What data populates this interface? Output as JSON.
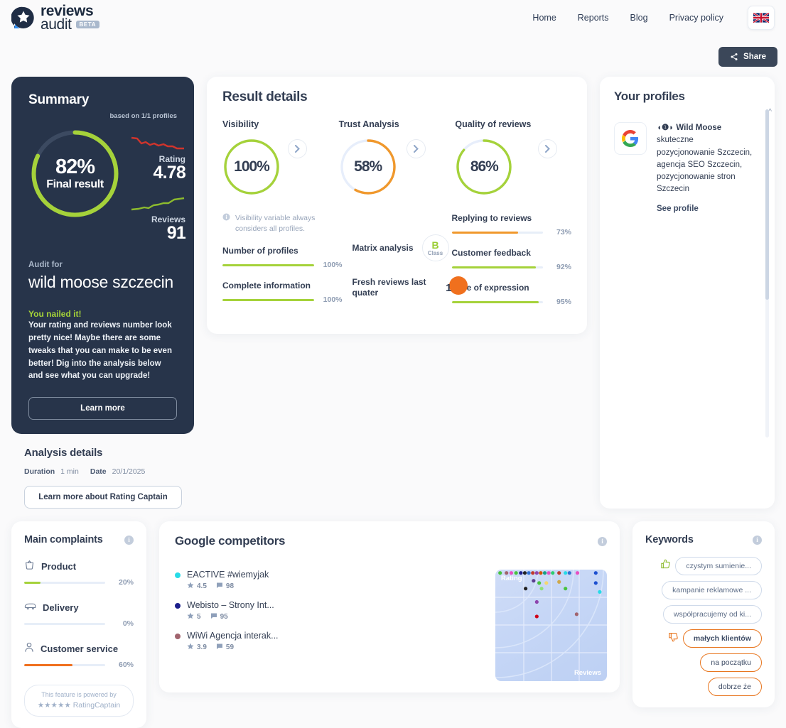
{
  "brand": {
    "line1": "reviews",
    "line2": "audit",
    "badge": "BETA"
  },
  "nav": {
    "items": [
      {
        "label": "Home"
      },
      {
        "label": "Reports"
      },
      {
        "label": "Blog"
      },
      {
        "label": "Privacy policy"
      }
    ],
    "language_flag": "uk-flag-icon"
  },
  "share": {
    "label": "Share",
    "icon": "share-icon"
  },
  "summary": {
    "title": "Summary",
    "based_on": "based on 1/1 profiles",
    "final_percent": "82%",
    "final_label": "Final result",
    "final_value": 82,
    "ring_color": "#a5d23a",
    "rating_label": "Rating",
    "rating_value": "4.78",
    "reviews_label": "Reviews",
    "reviews_value": "91",
    "audit_for_label": "Audit for",
    "audit_name": "wild moose szczecin",
    "callout_title": "You nailed it!",
    "callout_body": "Your rating and reviews number look pretty nice! Maybe there are some tweaks that you can make to be even better! Dig into the analysis below and see what you can upgrade!",
    "learn_more": "Learn more"
  },
  "analysis": {
    "title": "Analysis details",
    "duration_label": "Duration",
    "duration_value": "1 min",
    "date_label": "Date",
    "date_value": "20/1/2025",
    "button": "Learn more about Rating Captain"
  },
  "result_details": {
    "title": "Result details",
    "metrics": [
      {
        "title": "Visibility",
        "percent": "100%",
        "value": 100,
        "color": "#a5d23a"
      },
      {
        "title": "Trust Analysis",
        "percent": "58%",
        "value": 58,
        "color": "#f0982c"
      },
      {
        "title": "Quality of reviews",
        "percent": "86%",
        "value": 86,
        "color": "#a5d23a"
      }
    ],
    "note": "Visibility variable always considers all profiles.",
    "left_bars": [
      {
        "name": "Number of profiles",
        "percent": "100%",
        "value": 100,
        "color": "#a5d23a"
      },
      {
        "name": "Complete information",
        "percent": "100%",
        "value": 100,
        "color": "#a5d23a"
      }
    ],
    "middle": {
      "matrix_label": "Matrix analysis",
      "matrix_letter": "B",
      "matrix_class_word": "Class",
      "fresh_label": "Fresh reviews last quater",
      "fresh_value": "1",
      "fresh_color": "#f0701e"
    },
    "right_bars": [
      {
        "name": "Replying to reviews",
        "percent": "73%",
        "value": 73,
        "color": "#f0982c"
      },
      {
        "name": "Customer feedback",
        "percent": "92%",
        "value": 92,
        "color": "#a5d23a"
      },
      {
        "name": "Tone of expression",
        "percent": "95%",
        "value": 95,
        "color": "#a5d23a"
      }
    ]
  },
  "profiles": {
    "title": "Your profiles",
    "items": [
      {
        "source_icon": "google-icon",
        "prefix_glyphs": "◖❶◗",
        "name": "Wild Moose",
        "description": "skuteczne pozycjonowanie Szczecin, agencja SEO Szczecin, pozycjonowanie stron Szczecin",
        "link": "See profile"
      }
    ]
  },
  "complaints": {
    "title": "Main complaints",
    "items": [
      {
        "icon": "basket-icon",
        "name": "Product",
        "percent": "20%",
        "value": 20,
        "color": "#a5d23a"
      },
      {
        "icon": "truck-icon",
        "name": "Delivery",
        "percent": "0%",
        "value": 0,
        "color": "#a5d23a"
      },
      {
        "icon": "person-icon",
        "name": "Customer service",
        "percent": "60%",
        "value": 60,
        "color": "#f0701e"
      }
    ],
    "powered_line1": "This feature is powered by",
    "powered_stars": "★★★★★",
    "powered_brand": "RatingCaptain"
  },
  "competitors": {
    "title": "Google competitors",
    "items": [
      {
        "name": "EACTIVE #wiemyjak",
        "rating": "4.5",
        "reviews": "98",
        "color": "#27dbe7"
      },
      {
        "name": "Webisto – Strony Int...",
        "rating": "5",
        "reviews": "95",
        "color": "#1c1f8c"
      },
      {
        "name": "WiWi Agencja interak...",
        "rating": "3.9",
        "reviews": "59",
        "color": "#a1646e"
      }
    ],
    "chart_data": {
      "type": "scatter",
      "title": "",
      "xlabel": "Reviews",
      "ylabel": "Rating",
      "xlim": [
        0,
        100
      ],
      "ylim": [
        0,
        100
      ],
      "grid": true,
      "points": [
        {
          "x": 6,
          "y": 97,
          "color": "#47c33f"
        },
        {
          "x": 14,
          "y": 97,
          "color": "#a1646e"
        },
        {
          "x": 20,
          "y": 97,
          "color": "#e84fc2"
        },
        {
          "x": 26,
          "y": 97,
          "color": "#47c33f"
        },
        {
          "x": 32,
          "y": 97,
          "color": "#1c1f8c"
        },
        {
          "x": 37,
          "y": 97,
          "color": "#222222"
        },
        {
          "x": 42,
          "y": 97,
          "color": "#2f6fd0"
        },
        {
          "x": 47,
          "y": 97,
          "color": "#c0392b"
        },
        {
          "x": 52,
          "y": 97,
          "color": "#8e44ad"
        },
        {
          "x": 57,
          "y": 97,
          "color": "#d35400"
        },
        {
          "x": 62,
          "y": 97,
          "color": "#16a085"
        },
        {
          "x": 67,
          "y": 97,
          "color": "#e84fc2"
        },
        {
          "x": 72,
          "y": 97,
          "color": "#2ecc71"
        },
        {
          "x": 80,
          "y": 97,
          "color": "#c0392b"
        },
        {
          "x": 88,
          "y": 97,
          "color": "#27dbe7"
        },
        {
          "x": 93,
          "y": 97,
          "color": "#2f6fd0"
        },
        {
          "x": 103,
          "y": 97,
          "color": "#e84fc2"
        },
        {
          "x": 126,
          "y": 97,
          "color": "#1c4fd0"
        },
        {
          "x": 48,
          "y": 90,
          "color": "#5b3f8e"
        },
        {
          "x": 55,
          "y": 88,
          "color": "#47c33f"
        },
        {
          "x": 64,
          "y": 88,
          "color": "#f5d76e"
        },
        {
          "x": 80,
          "y": 89,
          "color": "#cfa84a"
        },
        {
          "x": 126,
          "y": 88,
          "color": "#1c4fd0"
        },
        {
          "x": 38,
          "y": 83,
          "color": "#222222"
        },
        {
          "x": 58,
          "y": 83,
          "color": "#8ee07a"
        },
        {
          "x": 88,
          "y": 83,
          "color": "#47c33f"
        },
        {
          "x": 131,
          "y": 80,
          "color": "#27dbe7"
        },
        {
          "x": 52,
          "y": 71,
          "color": "#8e44ad"
        },
        {
          "x": 52,
          "y": 58,
          "color": "#d0021b"
        },
        {
          "x": 102,
          "y": 60,
          "color": "#a1646e"
        }
      ]
    }
  },
  "keywords": {
    "title": "Keywords",
    "positive_icon": "thumbs-up-icon",
    "negative_icon": "thumbs-down-icon",
    "items": [
      {
        "label": "czystym sumienie...",
        "sentiment": "positive",
        "show_icon": true
      },
      {
        "label": "kampanie reklamowe ...",
        "sentiment": "positive",
        "show_icon": false
      },
      {
        "label": "współpracujemy od ki...",
        "sentiment": "positive",
        "show_icon": false
      },
      {
        "label": "małych klientów",
        "sentiment": "negative",
        "show_icon": true
      },
      {
        "label": "na początku",
        "sentiment": "negative",
        "show_icon": false
      },
      {
        "label": "dobrze że",
        "sentiment": "negative",
        "show_icon": false
      }
    ]
  }
}
